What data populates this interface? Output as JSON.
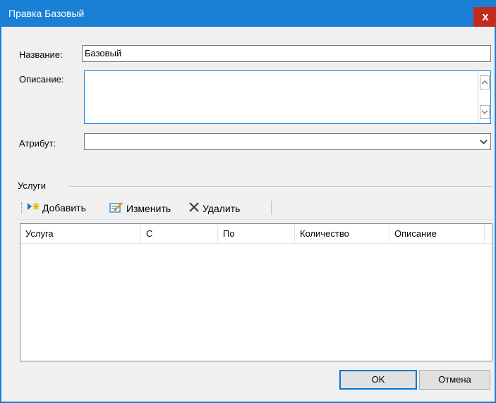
{
  "window": {
    "title": "Правка Базовый",
    "close_glyph": "x"
  },
  "form": {
    "name_label": "Название:",
    "name_value": "Базовый",
    "description_label": "Описание:",
    "description_value": "",
    "attribute_label": "Атрибут:",
    "attribute_value": ""
  },
  "services": {
    "group_label": "Услуги",
    "toolbar": {
      "add_label": "Добавить",
      "edit_label": "Изменить",
      "delete_label": "Удалить"
    },
    "columns": [
      "Услуга",
      "С",
      "По",
      "Количество",
      "Описание"
    ],
    "rows": []
  },
  "buttons": {
    "ok_label": "OK",
    "cancel_label": "Отмена"
  },
  "colors": {
    "title_bar": "#1a80d6",
    "close_button": "#c42b1c",
    "dialog_bg": "#f0f0f0"
  }
}
